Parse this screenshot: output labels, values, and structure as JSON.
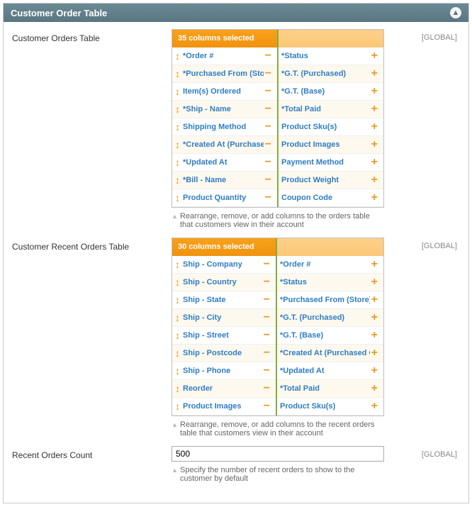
{
  "panel": {
    "title": "Customer Order Table"
  },
  "scope_label": "[GLOBAL]",
  "section1": {
    "label": "Customer Orders Table",
    "header_left": "35 columns selected",
    "left": [
      "*Order #",
      "*Purchased From (Store)",
      "Item(s) Ordered",
      "*Ship - Name",
      "Shipping Method",
      "*Created At (Purchased On)",
      "*Updated At",
      "*Bill - Name",
      "Product Quantity"
    ],
    "right": [
      "*Status",
      "*G.T. (Purchased)",
      "*G.T. (Base)",
      "*Total Paid",
      "Product Sku(s)",
      "Product Images",
      "Payment Method",
      "Product Weight",
      "Coupon Code"
    ],
    "hint": "Rearrange, remove, or add columns to the orders table that customers view in their account"
  },
  "section2": {
    "label": "Customer Recent Orders Table",
    "header_left": "30 columns selected",
    "left": [
      "Ship - Company",
      "Ship - Country",
      "Ship - State",
      "Ship - City",
      "Ship - Street",
      "Ship - Postcode",
      "Ship - Phone",
      "Reorder",
      "Product Images"
    ],
    "right": [
      "*Order #",
      "*Status",
      "*Purchased From (Store)",
      "*G.T. (Purchased)",
      "*G.T. (Base)",
      "*Created At (Purchased On)",
      "*Updated At",
      "*Total Paid",
      "Product Sku(s)"
    ],
    "hint": "Rearrange, remove, or add columns to the recent orders table that customers view in their account"
  },
  "section3": {
    "label": "Recent Orders Count",
    "value": "500",
    "hint": "Specify the number of recent orders to show to the customer by default"
  }
}
